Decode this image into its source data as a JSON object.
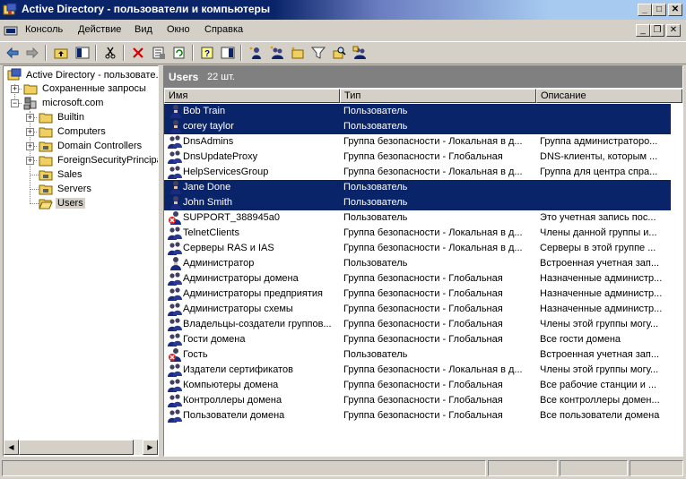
{
  "window": {
    "title": "Active Directory - пользователи и компьютеры",
    "minimize": "_",
    "maximize": "□",
    "close": "✕"
  },
  "menu": {
    "items": [
      "Консоль",
      "Действие",
      "Вид",
      "Окно",
      "Справка"
    ],
    "mdi_minimize": "_",
    "mdi_restore": "❐",
    "mdi_close": "✕"
  },
  "toolbar": {
    "icons": [
      "back-icon",
      "forward-icon",
      "up-folder-icon",
      "show-tree-icon",
      "cut-icon",
      "delete-icon",
      "properties-icon",
      "refresh-icon",
      "help-icon",
      "details-view-icon",
      "new-user-icon",
      "new-group-icon",
      "new-ou-icon",
      "filter-icon",
      "find-icon",
      "add-to-group-icon"
    ]
  },
  "tree": {
    "root": "Active Directory - пользовате...",
    "saved_queries": "Сохраненные запросы",
    "domain": "microsoft.com",
    "children": [
      "Builtin",
      "Computers",
      "Domain Controllers",
      "ForeignSecurityPrincipa...",
      "Sales",
      "Servers",
      "Users"
    ]
  },
  "right": {
    "title": "Users",
    "count": "22 шт.",
    "columns": [
      "Имя",
      "Тип",
      "Описание"
    ],
    "rows": [
      {
        "name": "Bob Train",
        "type": "Пользователь",
        "desc": "",
        "icon": "user",
        "selected": true
      },
      {
        "name": "corey taylor",
        "type": "Пользователь",
        "desc": "",
        "icon": "user",
        "selected": true
      },
      {
        "name": "DnsAdmins",
        "type": "Группа безопасности - Локальная в д...",
        "desc": "Группа администраторо...",
        "icon": "group",
        "selected": false
      },
      {
        "name": "DnsUpdateProxy",
        "type": "Группа безопасности - Глобальная",
        "desc": "DNS-клиенты, которым ...",
        "icon": "group",
        "selected": false
      },
      {
        "name": "HelpServicesGroup",
        "type": "Группа безопасности - Локальная в д...",
        "desc": "Группа для центра спра...",
        "icon": "group",
        "selected": false
      },
      {
        "name": "Jane Done",
        "type": "Пользователь",
        "desc": "",
        "icon": "user",
        "selected": true
      },
      {
        "name": "John Smith",
        "type": "Пользователь",
        "desc": "",
        "icon": "user",
        "selected": true
      },
      {
        "name": "SUPPORT_388945a0",
        "type": "Пользователь",
        "desc": "Это учетная запись пос...",
        "icon": "user-disabled",
        "selected": false
      },
      {
        "name": "TelnetClients",
        "type": "Группа безопасности - Локальная в д...",
        "desc": "Члены данной группы и...",
        "icon": "group",
        "selected": false
      },
      {
        "name": "Серверы RAS и IAS",
        "type": "Группа безопасности - Локальная в д...",
        "desc": "Серверы в этой группе ...",
        "icon": "group",
        "selected": false
      },
      {
        "name": "Администратор",
        "type": "Пользователь",
        "desc": "Встроенная учетная зап...",
        "icon": "user",
        "selected": false
      },
      {
        "name": "Администраторы домена",
        "type": "Группа безопасности - Глобальная",
        "desc": "Назначенные администр...",
        "icon": "group",
        "selected": false
      },
      {
        "name": "Администраторы предприятия",
        "type": "Группа безопасности - Глобальная",
        "desc": "Назначенные администр...",
        "icon": "group",
        "selected": false
      },
      {
        "name": "Администраторы схемы",
        "type": "Группа безопасности - Глобальная",
        "desc": "Назначенные администр...",
        "icon": "group",
        "selected": false
      },
      {
        "name": "Владельцы-создатели группов...",
        "type": "Группа безопасности - Глобальная",
        "desc": "Члены этой группы могу...",
        "icon": "group",
        "selected": false
      },
      {
        "name": "Гости домена",
        "type": "Группа безопасности - Глобальная",
        "desc": "Все гости домена",
        "icon": "group",
        "selected": false
      },
      {
        "name": "Гость",
        "type": "Пользователь",
        "desc": "Встроенная учетная зап...",
        "icon": "user-disabled",
        "selected": false
      },
      {
        "name": "Издатели сертификатов",
        "type": "Группа безопасности - Локальная в д...",
        "desc": "Члены этой группы могу...",
        "icon": "group",
        "selected": false
      },
      {
        "name": "Компьютеры домена",
        "type": "Группа безопасности - Глобальная",
        "desc": "Все рабочие станции и ...",
        "icon": "group",
        "selected": false
      },
      {
        "name": "Контроллеры домена",
        "type": "Группа безопасности - Глобальная",
        "desc": "Все контроллеры домен...",
        "icon": "group",
        "selected": false
      },
      {
        "name": "Пользователи домена",
        "type": "Группа безопасности - Глобальная",
        "desc": "Все пользователи домена",
        "icon": "group",
        "selected": false
      }
    ]
  },
  "colors": {
    "selection": "#0a246a",
    "face": "#d4d0c8",
    "header_band": "#808080"
  }
}
